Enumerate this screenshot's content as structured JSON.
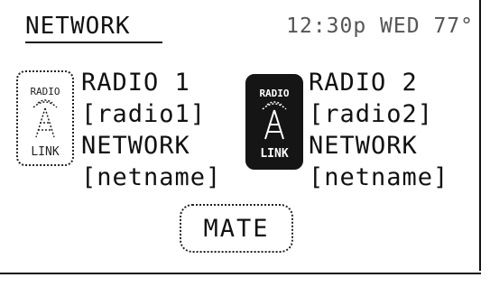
{
  "header": {
    "title": "NETWORK",
    "status": "12:30p WED 77°"
  },
  "radios": [
    {
      "name": "RADIO 1",
      "id_label": "[radio1]",
      "network_label": "NETWORK",
      "netname": "[netname]",
      "icon": "radio-link-icon",
      "icon_text_top": "RADIO",
      "icon_text_bottom": "LINK",
      "active": false
    },
    {
      "name": "RADIO 2",
      "id_label": "[radio2]",
      "network_label": "NETWORK",
      "netname": "[netname]",
      "icon": "radio-link-icon",
      "icon_text_top": "RADIO",
      "icon_text_bottom": "LINK",
      "active": true
    }
  ],
  "buttons": {
    "mate_label": "MATE"
  },
  "colors": {
    "foreground": "#111111",
    "background": "#ffffff",
    "status_text": "#555555"
  }
}
